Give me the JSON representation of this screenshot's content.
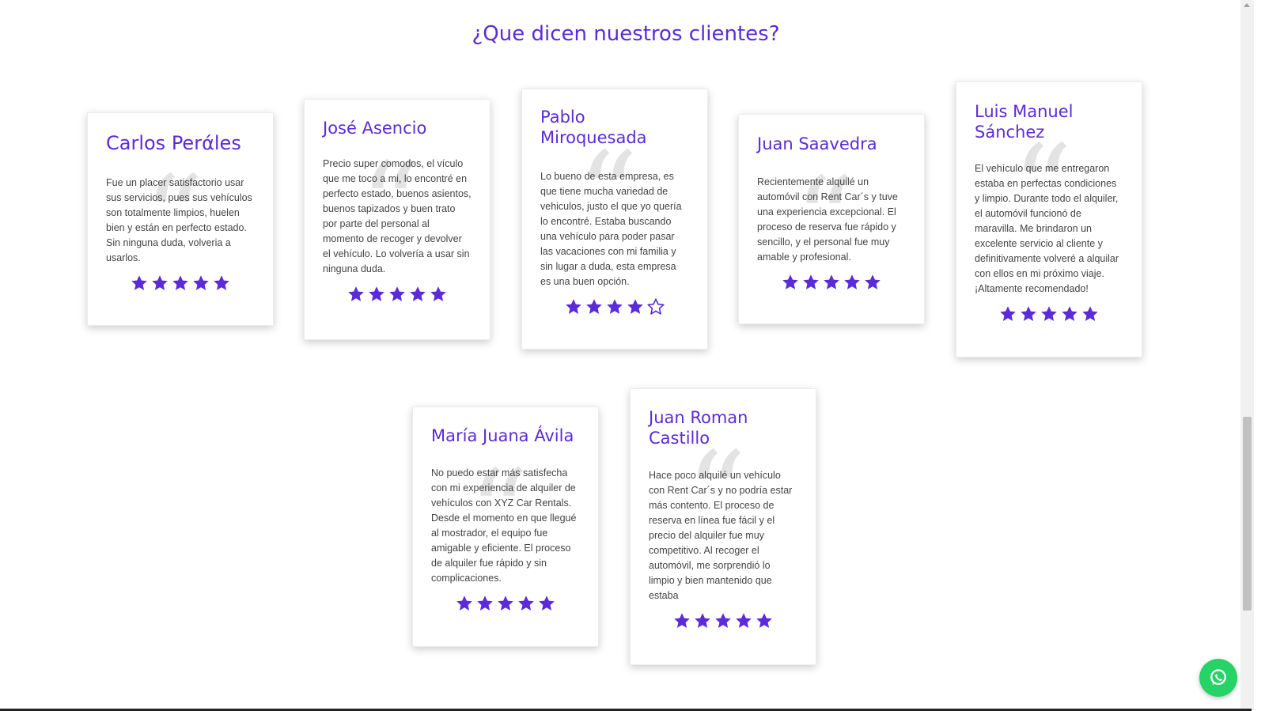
{
  "section": {
    "title": "¿Que dicen nuestros clientes?"
  },
  "colors": {
    "accent": "#5b2bd9",
    "whatsapp": "#25d366"
  },
  "testimonials": [
    {
      "name": "Carlos Perάles",
      "text": "Fue un placer satisfactorio usar sus servicios, pues sus vehículos son totalmente limpios, huelen bien y están en perfecto estado. Sin ninguna duda, volveria a usarlos.",
      "rating": 5
    },
    {
      "name": "José Asencio",
      "text": "Precio super comodos, el vículo que me toco a mi, lo encontré en perfecto estado, buenos asientos, buenos tapizados y buen trato por parte del personal al momento de recoger y devolver el vehículo. Lo volvería a usar sin ninguna duda.",
      "rating": 5
    },
    {
      "name": "Pablo Miroquesada",
      "text": "Lo bueno de esta empresa, es que tiene mucha variedad de vehiculos, justo el que yo quería lo encontré. Estaba buscando una vehículo para poder pasar las vacaciones con mi familia y sin lugar a duda, esta empresa es una buen opción.",
      "rating": 4
    },
    {
      "name": "Juan Saavedra",
      "text": "Recientemente alquilé un automóvil con Rent Car´s y tuve una experiencia excepcional. El proceso de reserva fue rápido y sencillo, y el personal fue muy amable y profesional.",
      "rating": 5
    },
    {
      "name": "Luis Manuel Sánchez",
      "text": "El vehículo que me entregaron estaba en perfectas condiciones y limpio. Durante todo el alquiler, el automóvil funcionó de maravilla. Me brindaron un excelente servicio al cliente y definitivamente volveré a alquilar con ellos en mi próximo viaje. ¡Altamente recomendado!",
      "rating": 5
    },
    {
      "name": "María Juana Ávila",
      "text": "No puedo estar más satisfecha con mi experiencia de alquiler de vehículos con XYZ Car Rentals. Desde el momento en que llegué al mostrador, el equipo fue amigable y eficiente. El proceso de alquiler fue rápido y sin complicaciones.",
      "rating": 5
    },
    {
      "name": "Juan Roman Castillo",
      "text": "Hace poco alquilé un vehículo con Rent Car´s y no podría estar más contento. El proceso de reserva en línea fue fácil y el precio del alquiler fue muy competitivo. Al recoger el automóvil, me sorprendió lo limpio y bien mantenido que estaba",
      "rating": 5
    }
  ],
  "floating": {
    "icon": "whatsapp-icon"
  }
}
